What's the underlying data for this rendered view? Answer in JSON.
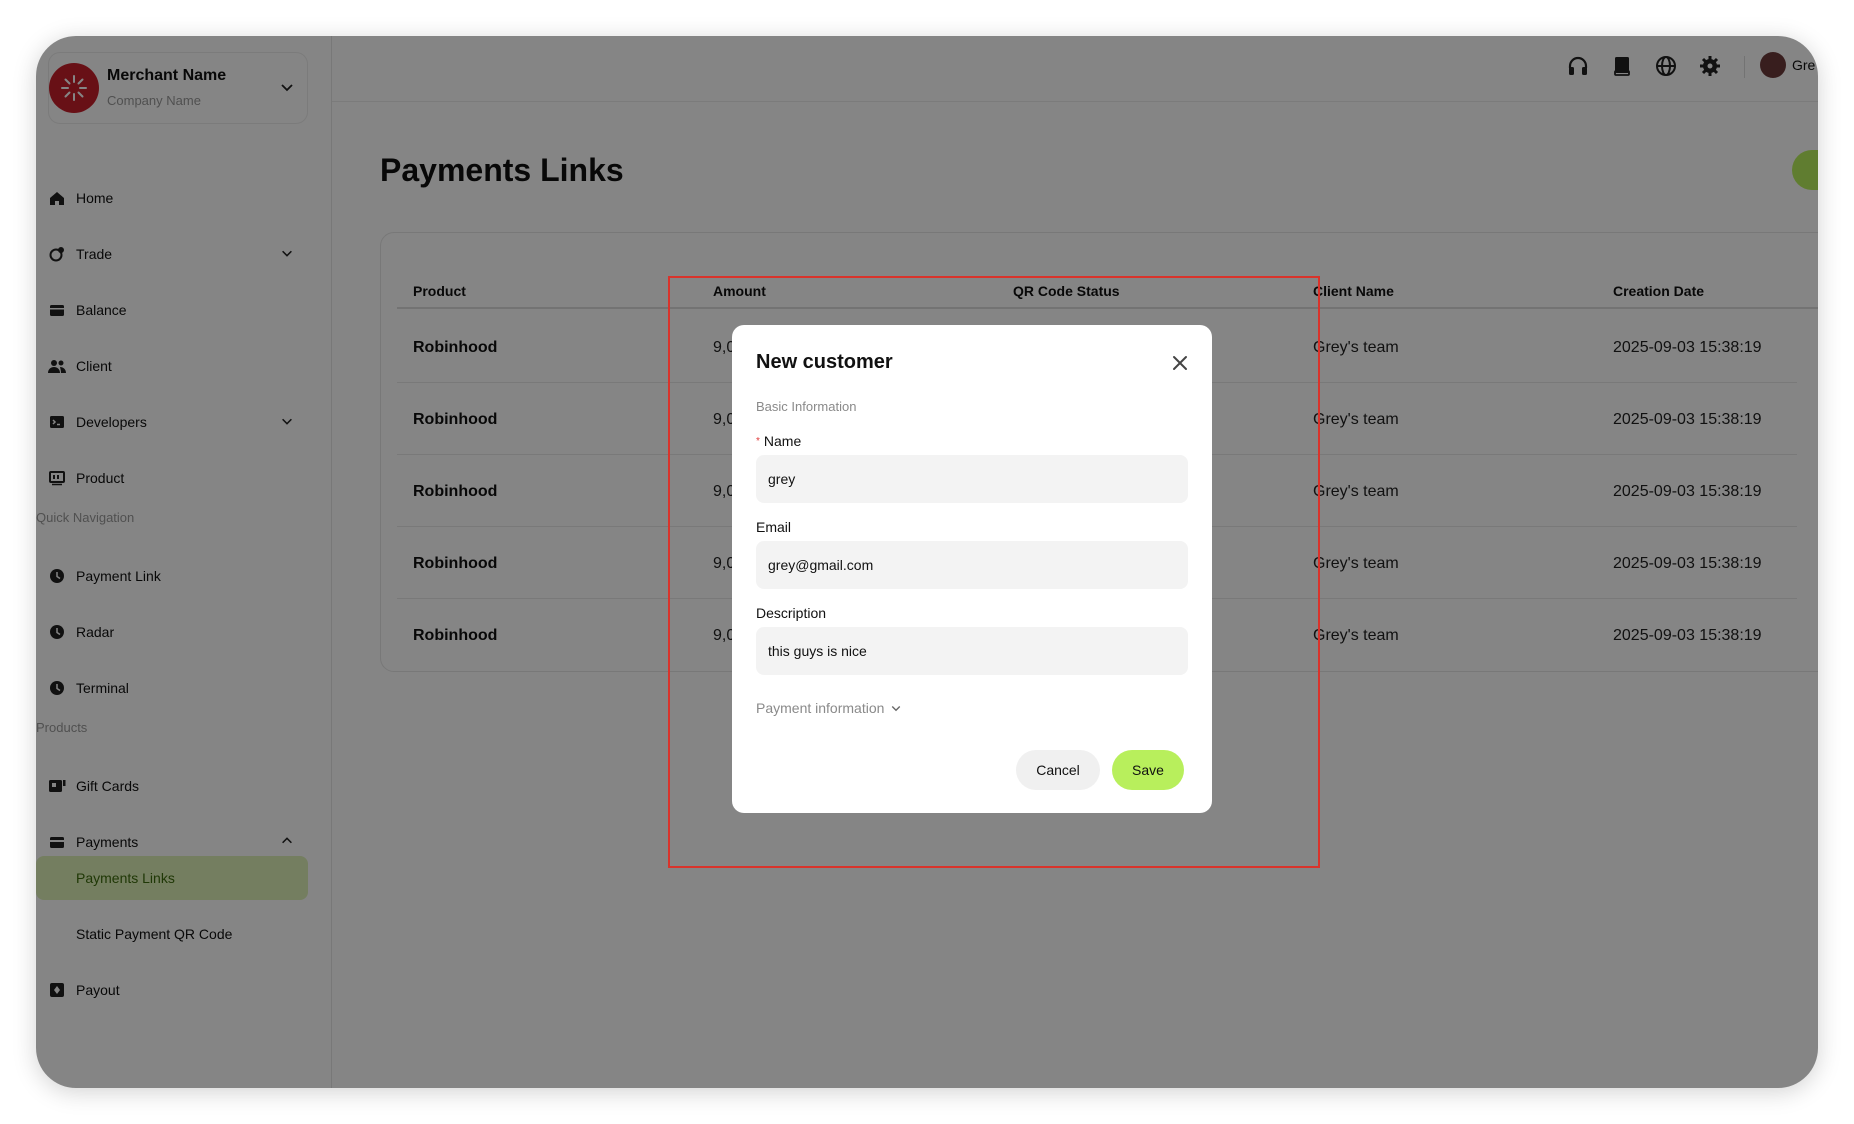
{
  "merchant": {
    "name": "Merchant Name",
    "company": "Company Name"
  },
  "sidebar": {
    "items": [
      {
        "label": "Home",
        "icon": "home-icon"
      },
      {
        "label": "Trade",
        "icon": "trade-icon"
      },
      {
        "label": "Balance",
        "icon": "balance-icon"
      },
      {
        "label": "Client",
        "icon": "client-icon"
      },
      {
        "label": "Developers",
        "icon": "developers-icon"
      },
      {
        "label": "Product",
        "icon": "product-icon"
      }
    ],
    "quick_nav_title": "Quick Navigation",
    "quick_nav": [
      {
        "label": "Payment Link",
        "icon": "clock-icon"
      },
      {
        "label": "Radar",
        "icon": "clock-icon"
      },
      {
        "label": "Terminal",
        "icon": "clock-icon"
      }
    ],
    "products_title": "Products",
    "products": [
      {
        "label": "Gift Cards",
        "icon": "gift-card-icon"
      },
      {
        "label": "Payments",
        "icon": "payments-icon"
      },
      {
        "label": "Payments Links"
      },
      {
        "label": "Static Payment QR Code"
      },
      {
        "label": "Payout",
        "icon": "payout-icon"
      }
    ]
  },
  "header": {
    "user_name": "Gre"
  },
  "page": {
    "title": "Payments Links"
  },
  "table": {
    "headers": [
      "Product",
      "Amount",
      "QR Code Status",
      "Client Name",
      "Creation Date"
    ],
    "rows": [
      {
        "product": "Robinhood",
        "amount": "9,0",
        "client": "Grey's team",
        "date": "2025-09-03 15:38:19"
      },
      {
        "product": "Robinhood",
        "amount": "9,0",
        "client": "Grey's team",
        "date": "2025-09-03 15:38:19"
      },
      {
        "product": "Robinhood",
        "amount": "9,0",
        "client": "Grey's team",
        "date": "2025-09-03 15:38:19"
      },
      {
        "product": "Robinhood",
        "amount": "9,0",
        "client": "Grey's team",
        "date": "2025-09-03 15:38:19"
      },
      {
        "product": "Robinhood",
        "amount": "9,0",
        "client": "Grey's team",
        "date": "2025-09-03 15:38:19"
      }
    ]
  },
  "modal": {
    "title": "New customer",
    "section": "Basic Information",
    "name_label": "Name",
    "name_value": "grey",
    "email_label": "Email",
    "email_value": "grey@gmail.com",
    "description_label": "Description",
    "description_value": "this guys is nice",
    "payment_info": "Payment information",
    "cancel_label": "Cancel",
    "save_label": "Save"
  },
  "colors": {
    "accent": "#b8ef5c",
    "active_bg": "#dff1b8",
    "active_text": "#3d6b0c",
    "brand": "#c8202b",
    "highlight": "#d9332b"
  }
}
